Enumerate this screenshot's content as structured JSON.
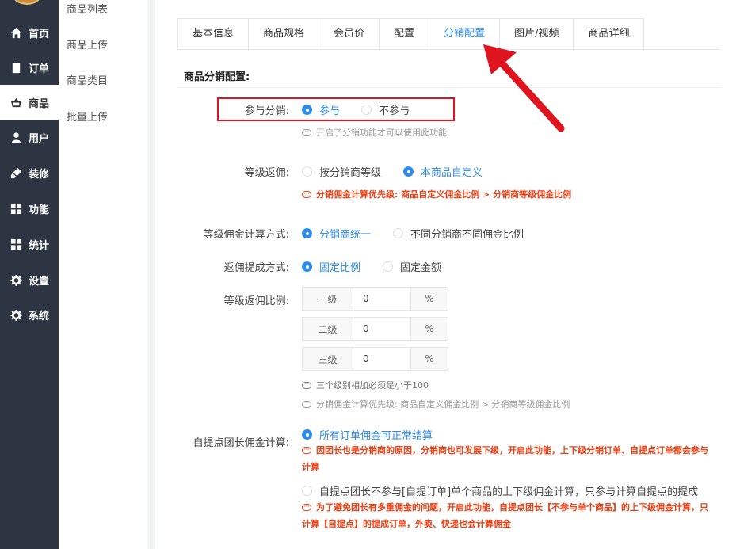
{
  "nav": {
    "items": [
      {
        "label": "首页",
        "icon": "home-icon"
      },
      {
        "label": "订单",
        "icon": "clipboard-icon"
      },
      {
        "label": "商品",
        "icon": "basket-icon"
      },
      {
        "label": "用户",
        "icon": "user-icon"
      },
      {
        "label": "装修",
        "icon": "brush-icon"
      },
      {
        "label": "功能",
        "icon": "grid-icon"
      },
      {
        "label": "统计",
        "icon": "grid-icon"
      },
      {
        "label": "设置",
        "icon": "gear-icon"
      },
      {
        "label": "系统",
        "icon": "gear-icon"
      }
    ],
    "active": "商品"
  },
  "submenu": [
    "商品列表",
    "商品上传",
    "商品类目",
    "批量上传"
  ],
  "tabs": [
    "基本信息",
    "商品规格",
    "会员价",
    "配置",
    "分销配置",
    "图片/视频",
    "商品详细"
  ],
  "active_tab": "分销配置",
  "section_title": "商品分销配置:",
  "form": {
    "participate": {
      "label": "参与分销:",
      "options": [
        "参与",
        "不参与"
      ],
      "selected": "参与",
      "hint": "开启了分销功能才可以使用此功能"
    },
    "level_rebate": {
      "label": "等级返佣:",
      "options": [
        "按分销商等级",
        "本商品自定义"
      ],
      "selected": "本商品自定义",
      "hint": "分销佣金计算优先级: 商品自定义佣金比例 > 分销商等级佣金比例"
    },
    "calc_method": {
      "label": "等级佣金计算方式:",
      "options": [
        "分销商统一",
        "不同分销商不同佣金比例"
      ],
      "selected": "分销商统一"
    },
    "withdraw_method": {
      "label": "返佣提成方式:",
      "options": [
        "固定比例",
        "固定金额"
      ],
      "selected": "固定比例"
    },
    "ratio": {
      "label": "等级返佣比例:",
      "levels": [
        {
          "name": "一级",
          "value": "0",
          "unit": "%"
        },
        {
          "name": "二级",
          "value": "0",
          "unit": "%"
        },
        {
          "name": "三级",
          "value": "0",
          "unit": "%"
        }
      ],
      "hint1": "三个级别相加必须是小于100",
      "hint2": "分销佣金计算优先级: 商品自定义佣金比例 > 分销商等级佣金比例"
    },
    "pickup_leader": {
      "label": "自提点团长佣金计算:",
      "option1": "所有订单佣金可正常结算",
      "option1_note_l1": "因团长也是分销商的原因，分销商也可发展下级，开启此功能，上下级分销订单、自提点订单都会参与",
      "option1_note_l2": "计算",
      "option2": "自提点团长不参与[自提订单]单个商品的上下级佣金计算，只参与计算自提点的提成",
      "option2_note_l1": "为了避免团长有多重佣金的问题，开启此功能，自提点团长【不参与单个商品】的上下级佣金计算，只",
      "option2_note_l2": "计算【自提点】的提成订单，外卖、快递也会计算佣金",
      "selected": "所有订单佣金可正常结算"
    }
  },
  "colors": {
    "accent": "#2d8cf0",
    "warning": "#ed4014",
    "highlight": "#e0141e",
    "sidebar": "#2d3542"
  }
}
